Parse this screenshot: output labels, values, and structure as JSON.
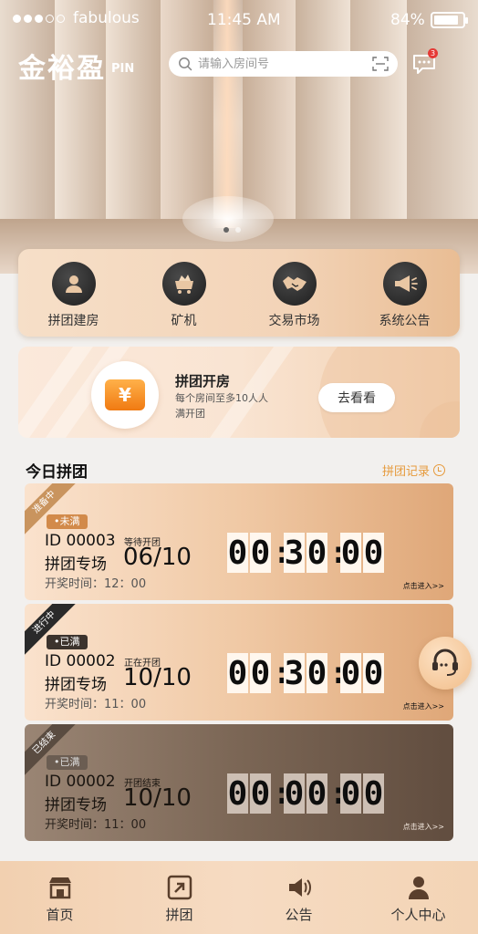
{
  "status_bar": {
    "carrier": "fabulous",
    "time": "11:45 AM",
    "battery": "84%"
  },
  "header": {
    "logo": "金裕盈",
    "logo_sub": "PIN",
    "search_placeholder": "请输入房间号",
    "message_badge": "3"
  },
  "shortcuts": [
    {
      "label": "拼团建房",
      "icon": "user-icon"
    },
    {
      "label": "矿机",
      "icon": "miner-cart-icon"
    },
    {
      "label": "交易市场",
      "icon": "handshake-icon"
    },
    {
      "label": "系统公告",
      "icon": "megaphone-icon"
    }
  ],
  "promo": {
    "icon_symbol": "¥",
    "title": "拼团开房",
    "desc": "每个房间至多10人人满开团",
    "button": "去看看"
  },
  "section": {
    "title": "今日拼团",
    "link": "拼团记录"
  },
  "rooms": [
    {
      "ribbon": "准备中",
      "status": "•未满",
      "id": "ID 00003",
      "name": "拼团专场",
      "state": "等待开团",
      "date": "06/10",
      "draw_time": "开奖时间：12：00",
      "countdown": [
        "0",
        "0",
        ":",
        "3",
        "0",
        ":",
        "0",
        "0"
      ],
      "enter": "点击进入>>"
    },
    {
      "ribbon": "进行中",
      "status": "•已满",
      "id": "ID 00002",
      "name": "拼团专场",
      "state": "正在开团",
      "date": "10/10",
      "draw_time": "开奖时间：11：00",
      "countdown": [
        "0",
        "0",
        ":",
        "3",
        "0",
        ":",
        "0",
        "0"
      ],
      "enter": "点击进入>>"
    },
    {
      "ribbon": "已结束",
      "status": "•已满",
      "id": "ID 00002",
      "name": "拼团专场",
      "state": "开团结束",
      "date": "10/10",
      "draw_time": "开奖时间：11：00",
      "countdown": [
        "0",
        "0",
        ":",
        "0",
        "0",
        ":",
        "0",
        "0"
      ],
      "enter": "点击进入>>"
    }
  ],
  "tabbar": [
    {
      "label": "首页",
      "icon": "shop-icon"
    },
    {
      "label": "拼团",
      "icon": "share-box-icon"
    },
    {
      "label": "公告",
      "icon": "speaker-icon"
    },
    {
      "label": "个人中心",
      "icon": "person-icon"
    }
  ]
}
